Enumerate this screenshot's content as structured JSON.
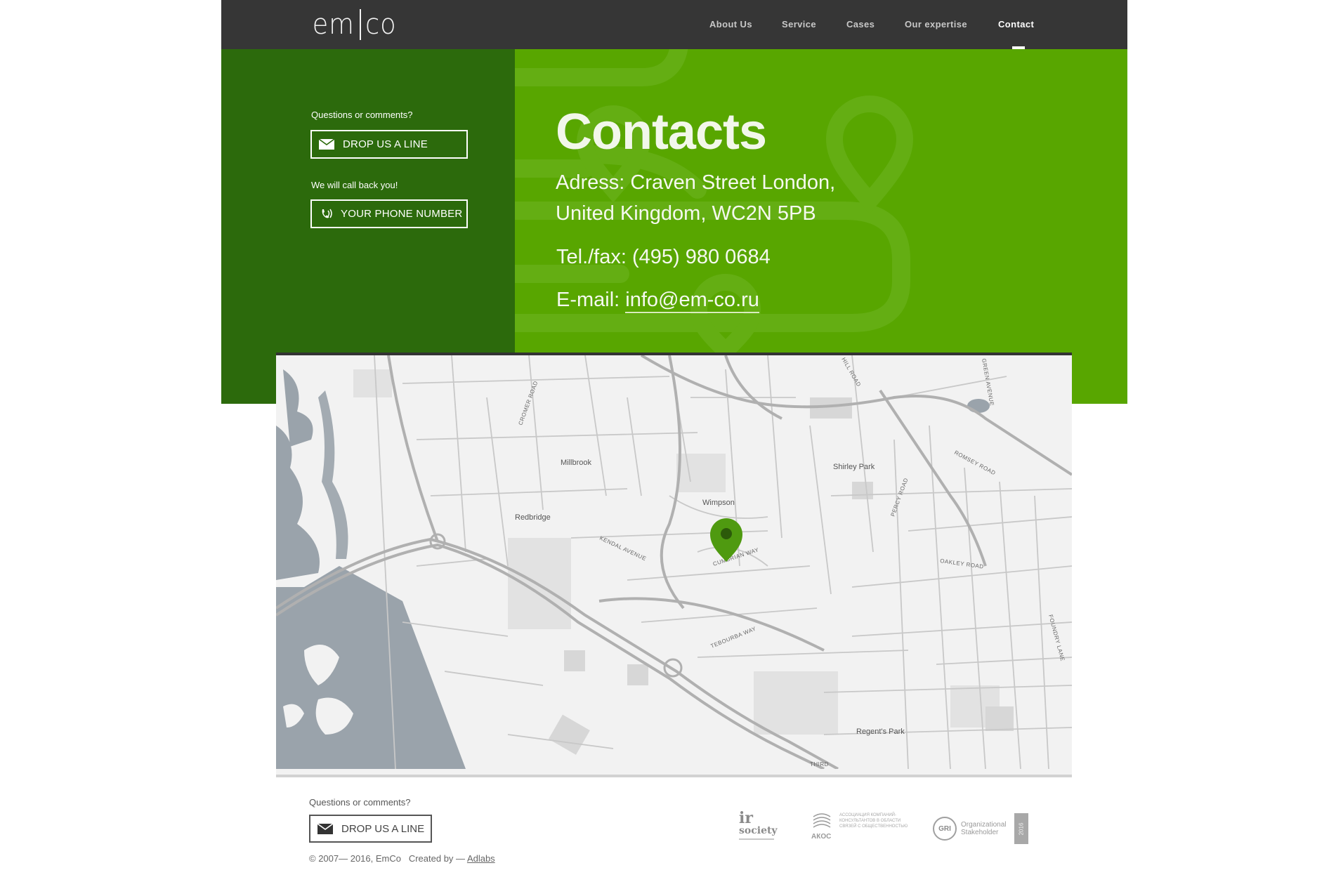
{
  "brand": {
    "logo_left": "em",
    "logo_right": "co"
  },
  "nav": {
    "items": [
      {
        "label": "About Us"
      },
      {
        "label": "Service"
      },
      {
        "label": "Cases"
      },
      {
        "label": "Our expertise"
      },
      {
        "label": "Contact"
      }
    ],
    "active": "Contact"
  },
  "sidebar": {
    "questions_label": "Questions or comments?",
    "drop_line_label": "DROP US A LINE",
    "callback_label": "We will call back you!",
    "phone_button_label": "YOUR PHONE NUMBER"
  },
  "contacts": {
    "title": "Contacts",
    "address_line1": "Adress:  Craven Street London,",
    "address_line2": "United Kingdom, WC2N 5PB",
    "phone": "Tel./fax: (495) 980 0684",
    "email_label": "E-mail: ",
    "email": "info@em-co.ru"
  },
  "map": {
    "places": [
      "Millbrook",
      "Redbridge",
      "Wimpson",
      "Shirley Park",
      "Regent's Park"
    ],
    "roads": [
      "CROMER ROAD",
      "KENDAL AVENUE",
      "CUMBRIAN WAY",
      "TEBOURBA WAY",
      "OAKLEY ROAD",
      "ROMSEY ROAD",
      "PERCY ROAD",
      "FOUNDRY LANE",
      "GREEN AVENUE",
      "HILL ROAD",
      "THIRD"
    ],
    "pin_icon": "map-pin-icon"
  },
  "footer": {
    "questions_label": "Questions or comments?",
    "drop_line_label": "DROP US A LINE",
    "copyright": "© 2007— 2016, EmCo",
    "created_by": "Created by — ",
    "created_by_link": "Adlabs",
    "partners": {
      "ir_society": {
        "mark": "ir",
        "name": "society"
      },
      "akos": {
        "name": "АКОС",
        "desc": "АССОЦИАЦИЯ КОМПАНИЙ-КОНСУЛЬТАНТОВ В ОБЛАСТИ СВЯЗЕЙ С ОБЩЕСТВЕННОСТЬЮ"
      },
      "gri": {
        "mark": "GRI",
        "text": "Organizational Stakeholder",
        "year": "2016"
      }
    }
  },
  "colors": {
    "header_bg": "#363636",
    "sidebar_green": "#2c6a0c",
    "hero_green": "#58a600",
    "pin_green": "#4f9a10",
    "water": "#9aa3ab"
  }
}
